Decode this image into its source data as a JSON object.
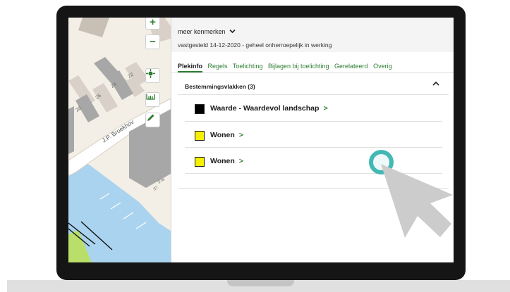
{
  "colors": {
    "accent": "#2e7d32",
    "swatch_black": "#000000",
    "swatch_yellow": "#f7f000",
    "water": "#aad3ef",
    "click_ring": "#43b8b4",
    "cursor": "#cccccc"
  },
  "map": {
    "street_label": "J.P. Broekhov",
    "house_numbers": [
      "28",
      "26",
      "24",
      "22",
      "37",
      "37a"
    ],
    "buttons": [
      {
        "name": "zoom-in",
        "glyph": "+"
      },
      {
        "name": "zoom-out",
        "glyph": "−"
      },
      {
        "name": "locate",
        "icon": "crosshair-icon"
      },
      {
        "name": "measure",
        "icon": "ruler-icon"
      },
      {
        "name": "draw",
        "icon": "pencil-icon"
      }
    ]
  },
  "panel": {
    "more_features": "meer kenmerken",
    "more_features_icon": "chevron-down-icon",
    "established": "vastgesteld 14-12-2020 - geheel onherroepelijk in werking",
    "tabs": [
      "Plekinfo",
      "Regels",
      "Toelichting",
      "Bijlagen bij toelichting",
      "Gerelateerd",
      "Overig"
    ],
    "active_tab": "Plekinfo",
    "section": {
      "title": "Bestemmingsvlakken (3)",
      "collapse_icon": "chevron-up-icon",
      "chevron_glyph": ">",
      "items": [
        {
          "label": "Waarde - Waardevol landschap",
          "swatch": "#000000"
        },
        {
          "label": "Wonen",
          "swatch": "#f7f000"
        },
        {
          "label": "Wonen",
          "swatch": "#f7f000"
        }
      ]
    }
  }
}
